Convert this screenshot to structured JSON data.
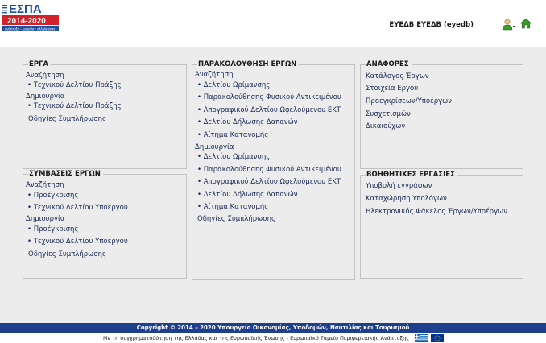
{
  "header": {
    "logo": {
      "title": "ΕΣΠΑ",
      "years": "2014-2020",
      "slogan": "ανάπτυξη - εργασία - αλληλεγγύη"
    },
    "user_name": "ΕΥΕΔΒ ΕΥΕΔΒ (eyedb)",
    "icons": [
      "user-menu-icon",
      "home-icon"
    ]
  },
  "panels": {
    "erga": {
      "title": "ΕΡΓΑ",
      "search_label": "Αναζήτηση",
      "search_items": [
        "Τεχνικού Δελτίου Πράξης"
      ],
      "create_label": "Δημιουργία",
      "create_items": [
        "Τεχνικού Δελτίου Πράξης"
      ],
      "help_link": "Οδηγίες Συμπλήρωσης"
    },
    "symvaseis": {
      "title": "ΣΥΜΒΑΣΕΙΣ ΕΡΓΩΝ",
      "search_label": "Αναζήτηση",
      "search_items": [
        "Προέγκρισης",
        "Τεχνικού Δελτίου Υποέργου"
      ],
      "create_label": "Δημιουργία",
      "create_items": [
        "Προέγκρισης",
        "Τεχνικού Δελτίου Υποέργου"
      ],
      "help_link": "Οδηγίες Συμπλήρωσης"
    },
    "parakolouthisi": {
      "title": "ΠΑΡΑΚΟΛΟΥΘΗΣΗ ΕΡΓΩΝ",
      "search_label": "Αναζήτηση",
      "search_items": [
        "Δελτίου Ωρίμανσης",
        "Παρακολούθησης Φυσικού Αντικειμένου",
        "Απογραφικού Δελτίου Ωφελούμενου ΕΚΤ",
        "Δελτίου Δήλωσης Δαπανών",
        "Αίτημα Κατανομής"
      ],
      "create_label": "Δημιουργία",
      "create_items": [
        "Δελτίου Ωρίμανσης",
        "Παρακολούθησης Φυσικού Αντικειμένου",
        "Απογραφικού Δελτίου Ωφελούμενου ΕΚΤ",
        "Δελτίου Δήλωσης Δαπανών",
        "Αίτημα Κατανομής"
      ],
      "help_link": "Οδηγίες Συμπλήρωσης"
    },
    "anafores": {
      "title": "ΑΝΑΦΟΡΕΣ",
      "items": [
        "Κατάλογος Έργων",
        "Στοιχεία Εργου",
        "Προεγκρίσεων/Υποέργων",
        "Συσχετισμών",
        "Δικαιούχων"
      ]
    },
    "voithitikes": {
      "title": "ΒΟΗΘΗΤΙΚΕΣ ΕΡΓΑΣΙΕΣ",
      "items": [
        "Υποβολή εγγράφων",
        "Καταχώρηση Υπολόγων",
        "Ηλεκτρονικός Φάκελος Έργων/Υποέργων"
      ]
    }
  },
  "footer": {
    "copyright": "Copyright © 2014 – 2020 Υπουργείο Οικονομίας, Υποδομών, Ναυτιλίας και Τουρισμού",
    "cofunding": "Με τη συγχρηματοδότηση της Ελλάδας και της Ευρωπαϊκής Ένωσης - Ευρωπαϊκό Ταμείο Περιφερειακής Ανάπτυξης",
    "flags": [
      "greek-flag-icon",
      "eu-flag-icon"
    ]
  },
  "colors": {
    "text": "#1b2a55",
    "footer_bar": "#1e3f8c",
    "logo_blue": "#1e4fa0",
    "logo_red": "#d2232a",
    "home_green": "#3a9a2a"
  }
}
